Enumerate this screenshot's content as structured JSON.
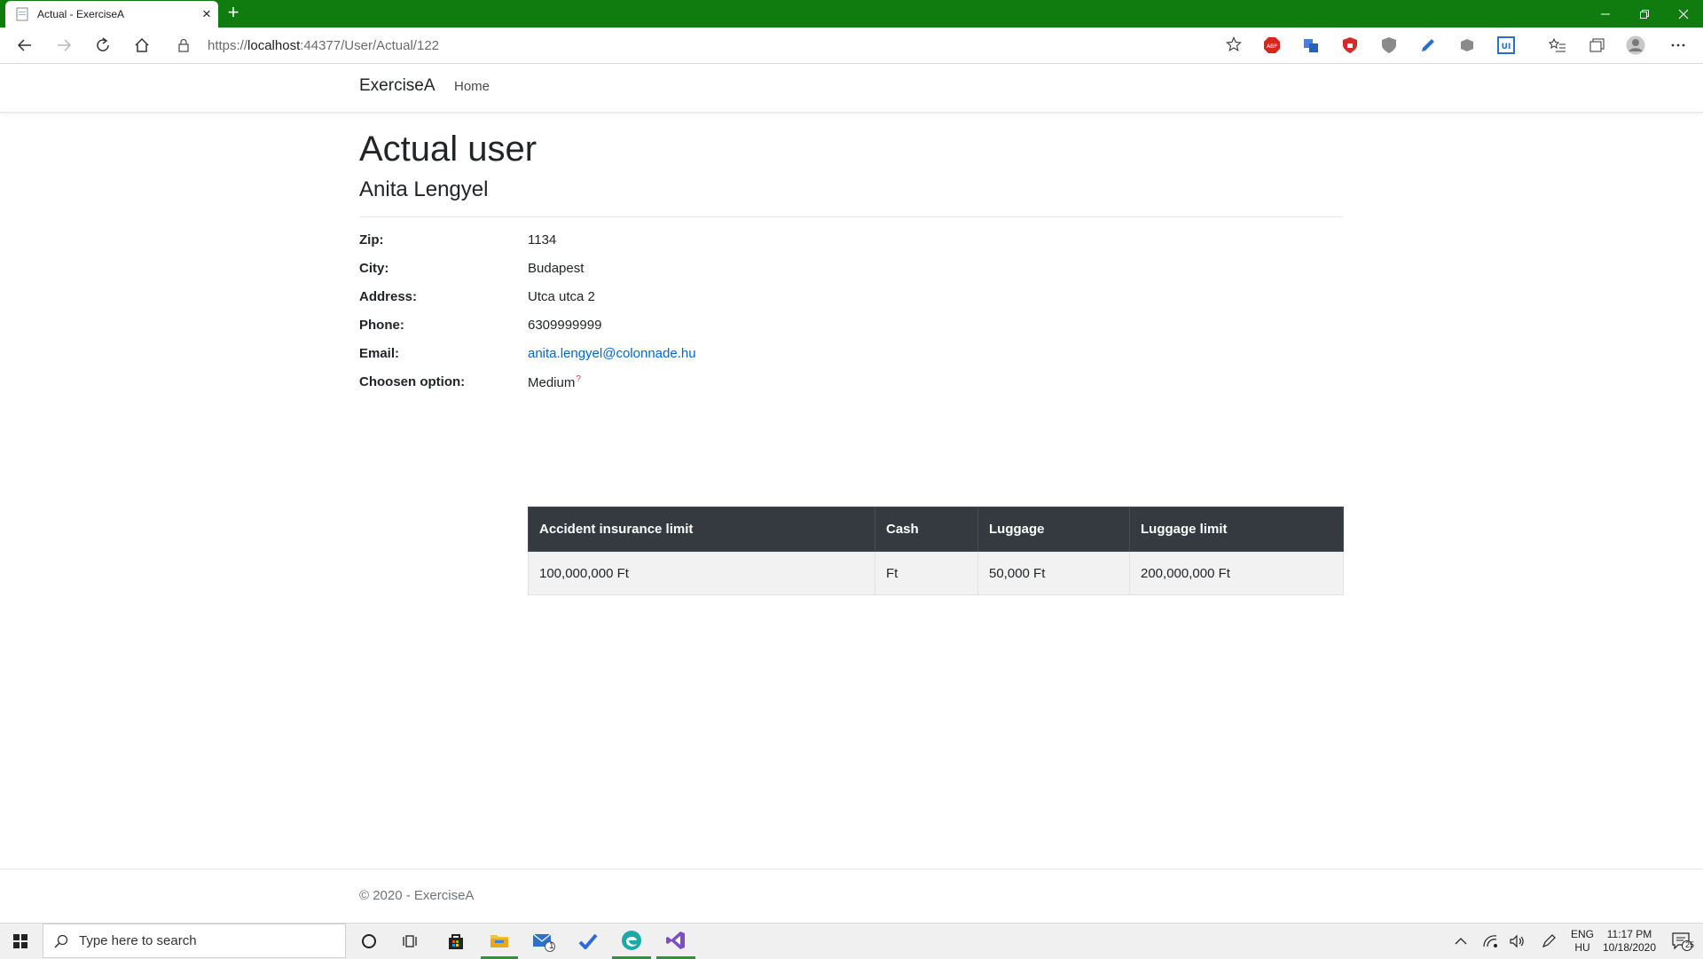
{
  "browser": {
    "tab_title": "Actual - ExerciseA",
    "url_prefix": "https://",
    "url_host": "localhost",
    "url_rest": ":44377/User/Actual/122",
    "accent": "#107c10"
  },
  "nav": {
    "brand": "ExerciseA",
    "home": "Home"
  },
  "page": {
    "title": "Actual user",
    "name": "Anita Lengyel"
  },
  "details": {
    "zip_label": "Zip:",
    "zip": "1134",
    "city_label": "City:",
    "city": "Budapest",
    "address_label": "Address:",
    "address": "Utca utca 2",
    "phone_label": "Phone:",
    "phone": "6309999999",
    "email_label": "Email:",
    "email": "anita.lengyel@colonnade.hu",
    "option_label": "Choosen option:",
    "option": "Medium",
    "option_sup": "?"
  },
  "option_table": {
    "headers": [
      "Accident insurance limit",
      "Cash",
      "Luggage",
      "Luggage limit"
    ],
    "rows": [
      [
        "100,000,000 Ft",
        "Ft",
        "50,000 Ft",
        "200,000,000 Ft"
      ]
    ]
  },
  "footer": {
    "text": "© 2020 - ExerciseA"
  },
  "taskbar": {
    "search_placeholder": "Type here to search",
    "lang_1": "ENG",
    "lang_2": "HU",
    "time": "11:17 PM",
    "date": "10/18/2020",
    "notif_count": "25",
    "mail_badge": "1"
  }
}
